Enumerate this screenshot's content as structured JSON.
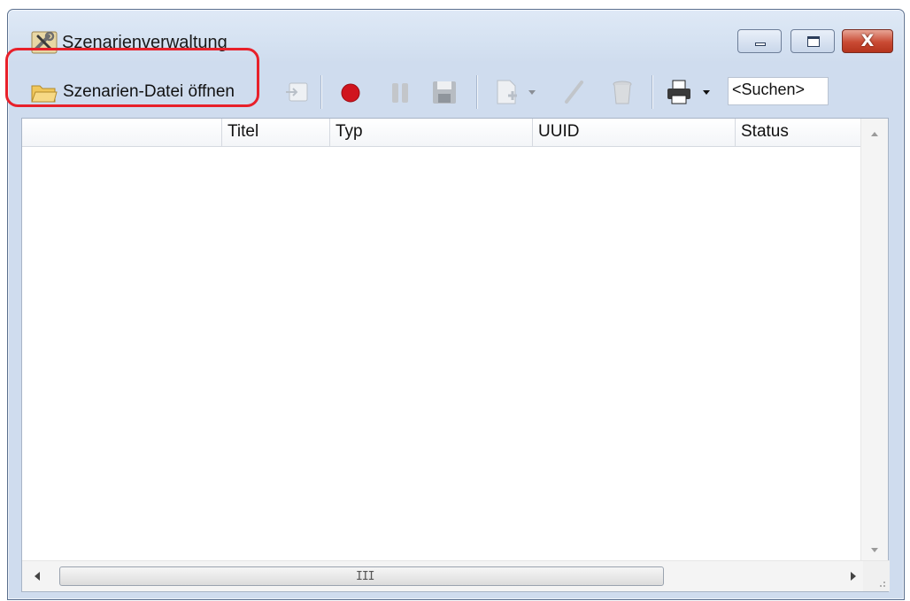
{
  "window": {
    "title": "Szenarienverwaltung",
    "icon": "wrench-screwdriver-icon",
    "controls": [
      "minimize",
      "maximize",
      "close"
    ],
    "close_glyph": "X"
  },
  "toolbar": {
    "open_label": "Szenarien-Datei öffnen",
    "tools": [
      "import-icon",
      "record-icon",
      "pause-icon",
      "save-icon",
      "new-document-icon",
      "edit-pencil-icon",
      "delete-trash-icon",
      "print-icon"
    ],
    "search_value": "<Suchen>"
  },
  "list": {
    "columns": [
      "",
      "Titel",
      "Typ",
      "UUID",
      "Status"
    ],
    "rows": []
  },
  "colors": {
    "highlight": "#e8202a",
    "record": "#d0141e",
    "close_button": "#c94a33"
  }
}
